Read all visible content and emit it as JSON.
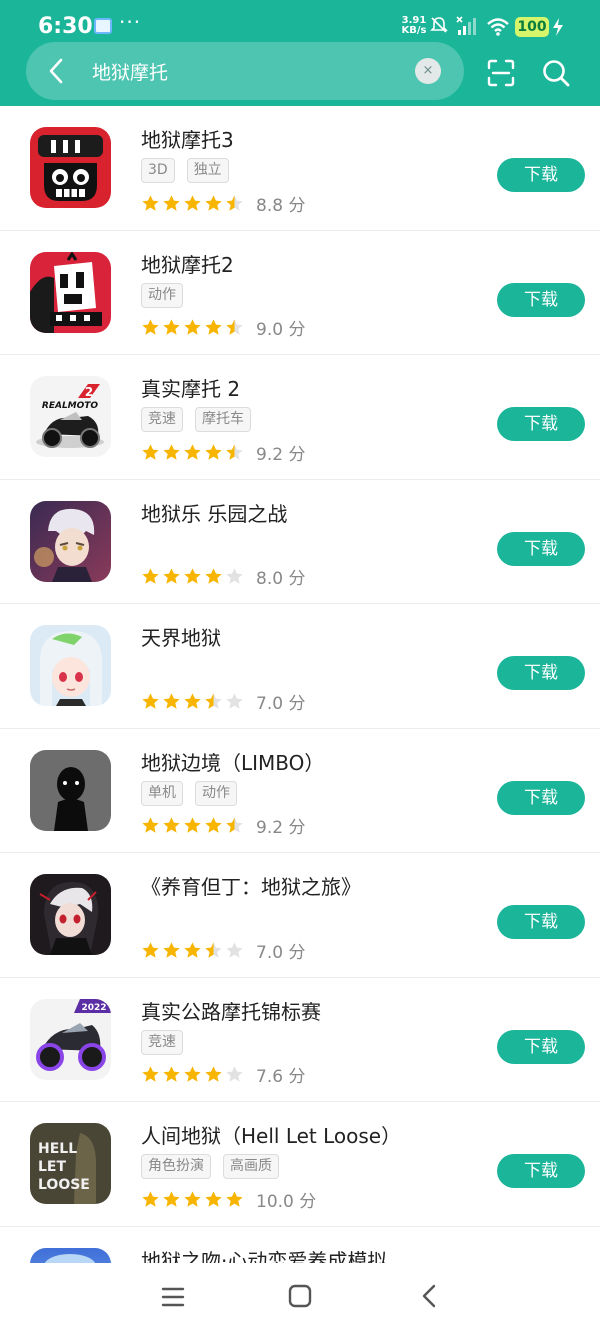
{
  "status_bar": {
    "time": "6:30",
    "overflow": "···",
    "net_speed_value": "3.91",
    "net_speed_unit": "KB/s",
    "battery": "100"
  },
  "search": {
    "query": "地狱摩托",
    "clear_glyph": "×"
  },
  "colors": {
    "accent": "#1bb59a",
    "star_filled": "#f7b500",
    "star_empty": "#e2e2e2"
  },
  "download_label": "下载",
  "results": [
    {
      "name": "地狱摩托3",
      "tags": [
        "3D",
        "独立"
      ],
      "stars": 4.5,
      "score": "8.8 分"
    },
    {
      "name": "地狱摩托2",
      "tags": [
        "动作"
      ],
      "stars": 4.5,
      "score": "9.0 分"
    },
    {
      "name": "真实摩托 2",
      "tags": [
        "竞速",
        "摩托车"
      ],
      "stars": 4.5,
      "score": "9.2 分"
    },
    {
      "name": "地狱乐 乐园之战",
      "tags": [],
      "stars": 4,
      "score": "8.0 分"
    },
    {
      "name": "天界地狱",
      "tags": [],
      "stars": 3.5,
      "score": "7.0 分"
    },
    {
      "name": "地狱边境（LIMBO）",
      "tags": [
        "单机",
        "动作"
      ],
      "stars": 4.5,
      "score": "9.2 分"
    },
    {
      "name": "《养育但丁：地狱之旅》",
      "tags": [],
      "stars": 3.5,
      "score": "7.0 分"
    },
    {
      "name": "真实公路摩托锦标赛",
      "tags": [
        "竞速"
      ],
      "stars": 4,
      "score": "7.6 分"
    },
    {
      "name": "人间地狱（Hell Let Loose）",
      "tags": [
        "角色扮演",
        "高画质"
      ],
      "stars": 5,
      "score": "10.0 分"
    },
    {
      "name": "地狱之吻·心动恋爱养成模拟",
      "tags": [],
      "stars": 0,
      "score": ""
    }
  ],
  "icon_art": {
    "real_moto_logo": "REALMOTO",
    "real_moto_number": "2",
    "moto_badge": "2022",
    "hell_let_loose_logo": [
      "HELL",
      "LET",
      "LOOSE"
    ]
  },
  "nav": {
    "menu": "menu-icon",
    "home": "home-icon",
    "back": "back-icon"
  }
}
